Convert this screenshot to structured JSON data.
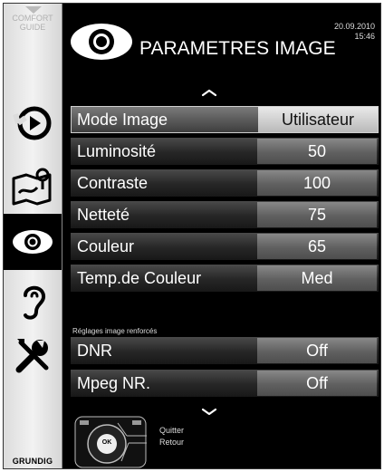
{
  "comfort_guide": {
    "label": "COMFORT\nGUIDE"
  },
  "brand": "GRUNDIG",
  "header": {
    "title": "PARAMETRES IMAGE",
    "date": "20.09.2010",
    "time": "15:46"
  },
  "sidebar": {
    "items": [
      {
        "name": "source",
        "icon": "play-circle-icon"
      },
      {
        "name": "installation",
        "icon": "map-pin-icon"
      },
      {
        "name": "picture",
        "icon": "eye-icon",
        "active": true
      },
      {
        "name": "sound",
        "icon": "ear-icon"
      },
      {
        "name": "settings",
        "icon": "tools-icon"
      }
    ]
  },
  "settings": [
    {
      "label": "Mode Image",
      "value": "Utilisateur",
      "selected": true
    },
    {
      "label": "Luminosité",
      "value": "50"
    },
    {
      "label": "Contraste",
      "value": "100"
    },
    {
      "label": "Netteté",
      "value": "75"
    },
    {
      "label": "Couleur",
      "value": "65"
    },
    {
      "label": "Temp.de Couleur",
      "value": "Med"
    }
  ],
  "enhanced": {
    "heading": "Réglages image renforcés",
    "items": [
      {
        "label": "DNR",
        "value": "Off"
      },
      {
        "label": "Mpeg NR.",
        "value": "Off"
      }
    ]
  },
  "remote": {
    "ok_label": "OK",
    "quit_label": "Quitter",
    "back_label": "Retour"
  },
  "colors": {
    "background": "#000000",
    "sidebar": "#e6e6e6",
    "row": "#2a2a2a",
    "value_box": "#6a6a6a",
    "selected_value": "#d8d8d8"
  }
}
